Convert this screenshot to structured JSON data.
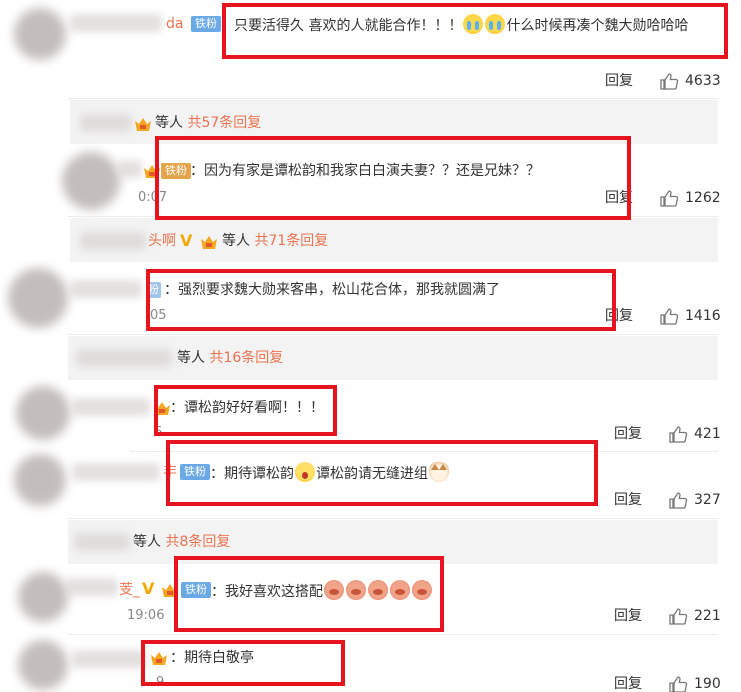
{
  "badge_label": "铁粉",
  "comments": [
    {
      "name_fragment": "da",
      "text": "只要活得久 喜欢的人就能合作！！！",
      "text_after": "什么时候再凑个魏大勋哈哈哈",
      "reply_label": "回复",
      "likes": "4633"
    },
    {
      "time_fragment": "0:07",
      "text": "：因为有家是谭松韵和我家白白演夫妻？？还是兄妹？？",
      "reply_label": "回复",
      "likes": "1262"
    },
    {
      "time_fragment": "05",
      "text": "：强烈要求魏大勋来客串，松山花合体，那我就圆满了",
      "reply_label": "回复",
      "likes": "1416"
    },
    {
      "time_fragment": "6",
      "text": "：谭松韵好好看啊！！！",
      "reply_label": "回复",
      "likes": "421"
    },
    {
      "name_fragment": "丰",
      "text": "：期待谭松韵",
      "text_mid": "谭松韵请无缝进组",
      "reply_label": "回复",
      "likes": "327"
    },
    {
      "name_fragment": "芰_",
      "time": "19:06",
      "text": "：我好喜欢这搭配",
      "reply_label": "回复",
      "likes": "221"
    },
    {
      "time_fragment": "9",
      "text": "：期待白敬亭",
      "reply_label": "回复",
      "likes": "190"
    }
  ],
  "reply_summaries": [
    {
      "prefix": "等人",
      "count_text": "共57条回复"
    },
    {
      "name_fragment": "头啊",
      "prefix": "等人",
      "count_text": "共71条回复"
    },
    {
      "prefix": "等人",
      "count_text": "共16条回复"
    },
    {
      "prefix": "等人",
      "count_text": "共8条回复"
    }
  ],
  "colors": {
    "highlight_box": "#e6141e",
    "link_orange": "#eb7350",
    "badge_blue": "#6ba9e6",
    "vip_gold": "#f2a900"
  },
  "icons": {
    "like": "thumbs-up-outline-icon",
    "crown": "gold-crown-icon",
    "verified": "gold-v-icon"
  }
}
